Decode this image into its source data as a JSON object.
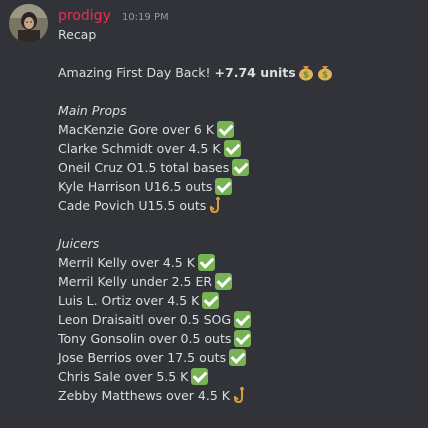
{
  "message": {
    "author": "prodigy",
    "timestamp": "10:19 PM",
    "title": "Recap",
    "summary": {
      "text": "Amazing First Day Back!",
      "units": "+7.74 units",
      "emojis": [
        "money-bag-icon",
        "money-bag-icon"
      ]
    },
    "sections": [
      {
        "title": "Main Props",
        "items": [
          {
            "text": "MacKenzie Gore over 6 K",
            "result": "check"
          },
          {
            "text": "Clarke Schmidt over 4.5 K",
            "result": "check"
          },
          {
            "text": "Oneil Cruz O1.5 total bases",
            "result": "check"
          },
          {
            "text": "Kyle Harrison U16.5 outs",
            "result": "check"
          },
          {
            "text": "Cade Povich U15.5 outs",
            "result": "hook"
          }
        ]
      },
      {
        "title": "Juicers",
        "items": [
          {
            "text": "Merril Kelly over 4.5 K",
            "result": "check"
          },
          {
            "text": "Merril Kelly under 2.5 ER",
            "result": "check"
          },
          {
            "text": "Luis L. Ortiz over 4.5 K",
            "result": "check"
          },
          {
            "text": "Leon Draisaitl over 0.5 SOG",
            "result": "check"
          },
          {
            "text": "Tony Gonsolin over 0.5 outs",
            "result": "check"
          },
          {
            "text": "Jose Berrios over 17.5 outs",
            "result": "check"
          },
          {
            "text": "Chris Sale over 5.5 K",
            "result": "check"
          },
          {
            "text": "Zebby Matthews over 4.5 K",
            "result": "hook"
          }
        ]
      }
    ]
  },
  "colors": {
    "background": "#313338",
    "username": "#e8304f",
    "check": "#77b255",
    "hook": "#d99e3c"
  }
}
